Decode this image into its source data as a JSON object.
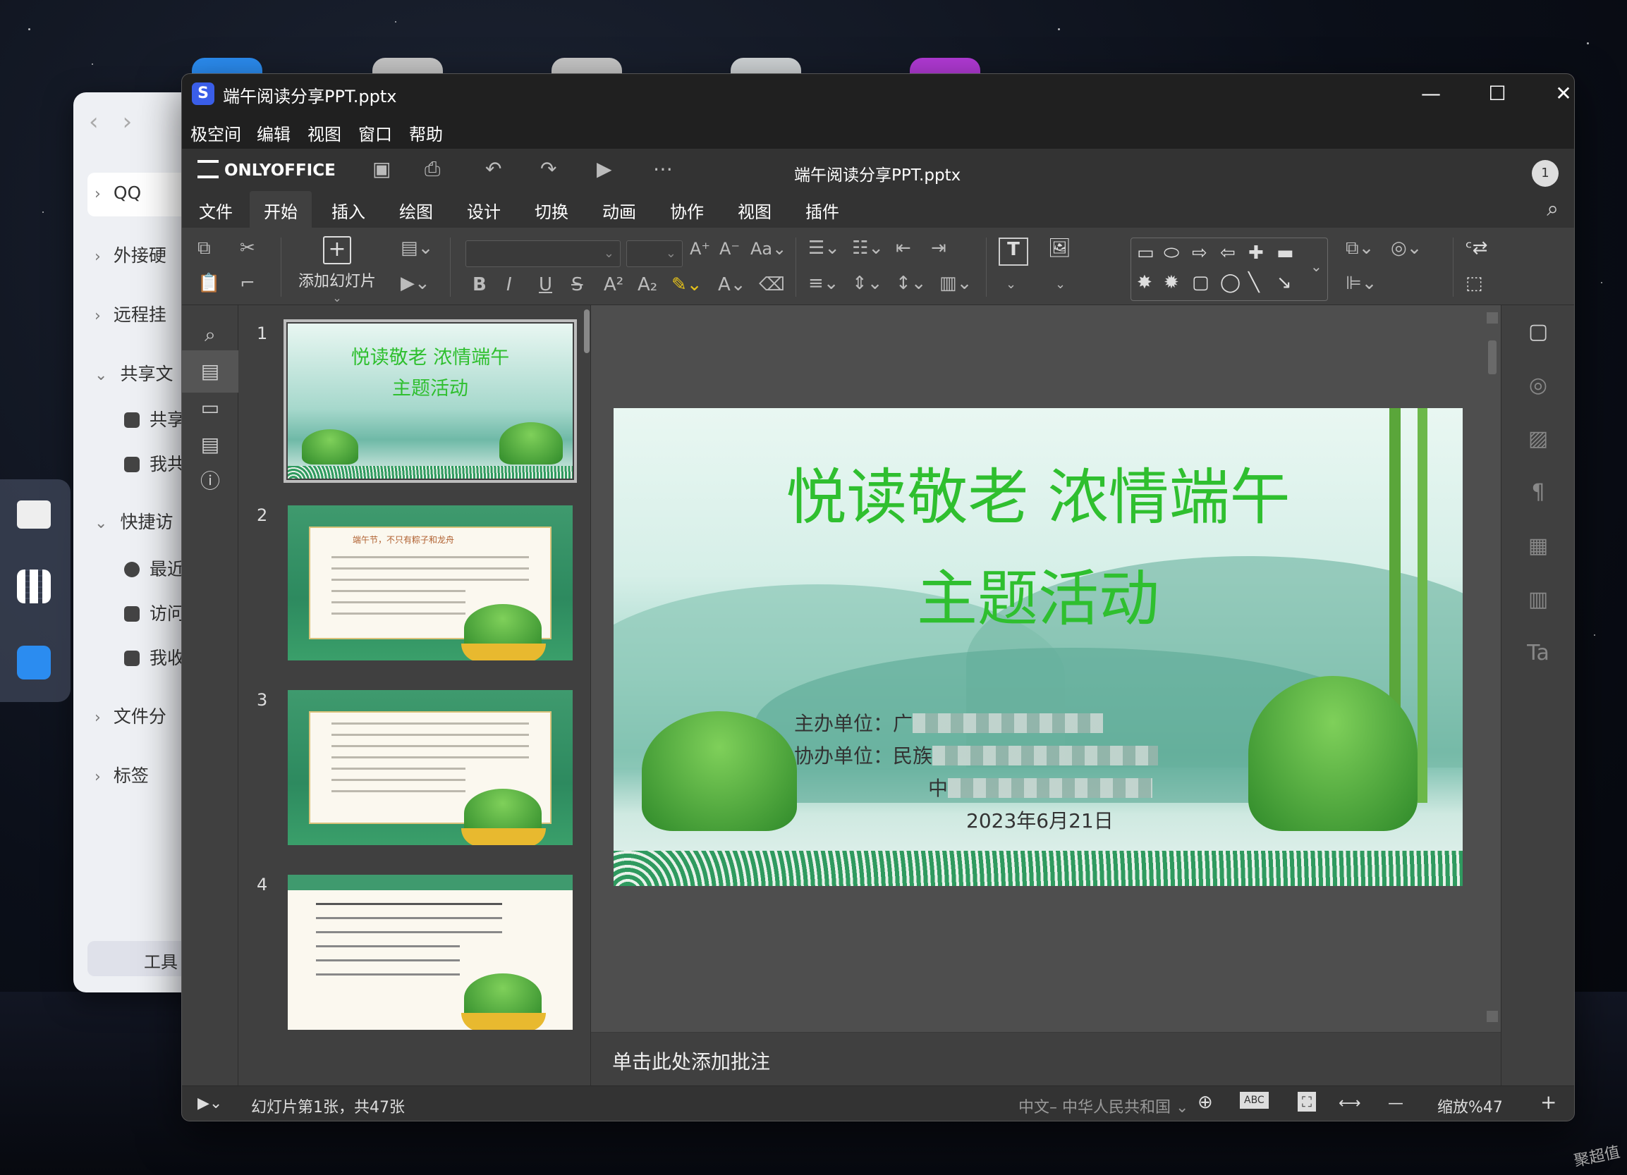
{
  "window": {
    "title": "端午阅读分享PPT.pptx",
    "controls": {
      "minimize": "—",
      "maximize": "☐",
      "close": "✕"
    }
  },
  "menubar": [
    "极空间",
    "编辑",
    "视图",
    "窗口",
    "帮助"
  ],
  "onlyoffice": {
    "brand": "ONLYOFFICE",
    "doc_title": "端午阅读分享PPT.pptx",
    "user_badge": "1",
    "tabs": [
      {
        "label": "文件",
        "active": false
      },
      {
        "label": "开始",
        "active": true
      },
      {
        "label": "插入",
        "active": false
      },
      {
        "label": "绘图",
        "active": false
      },
      {
        "label": "设计",
        "active": false
      },
      {
        "label": "切换",
        "active": false
      },
      {
        "label": "动画",
        "active": false
      },
      {
        "label": "协作",
        "active": false
      },
      {
        "label": "视图",
        "active": false
      },
      {
        "label": "插件",
        "active": false
      }
    ]
  },
  "toolbar": {
    "add_slide_label": "添加幻灯片"
  },
  "background_window": {
    "items": [
      "QQ",
      "外接硬",
      "远程挂",
      "共享文",
      "快捷访",
      "文件分",
      "标签"
    ],
    "sub_items": [
      "共享",
      "我共",
      "最近",
      "访问",
      "我收"
    ],
    "bottom_label": "工具"
  },
  "thumbnails": [
    {
      "number": "1",
      "title_line1": "悦读敬老 浓情端午",
      "title_line2": "主题活动",
      "subtitle": "端午节，不只有粽子和龙舟"
    },
    {
      "number": "2",
      "heading": "端午节，不只有粽子和龙舟"
    },
    {
      "number": "3"
    },
    {
      "number": "4"
    }
  ],
  "slide": {
    "title_line1": "悦读敬老  浓情端午",
    "title_line2": "主题活动",
    "host_label": "主办单位：广",
    "co_label": "协办单位：民族",
    "third_label": "中",
    "date": "2023年6月21日"
  },
  "notes_placeholder": "单击此处添加批注",
  "statusbar": {
    "slide_info": "幻灯片第1张，共47张",
    "language": "中文– 中华人民共和国",
    "zoom": "缩放%47",
    "zoom_out": "—",
    "zoom_in": "+"
  },
  "watermark": "聚超值",
  "colors": {
    "title_green": "#2fbf2f",
    "accent_blue": "#3a5ee8"
  }
}
